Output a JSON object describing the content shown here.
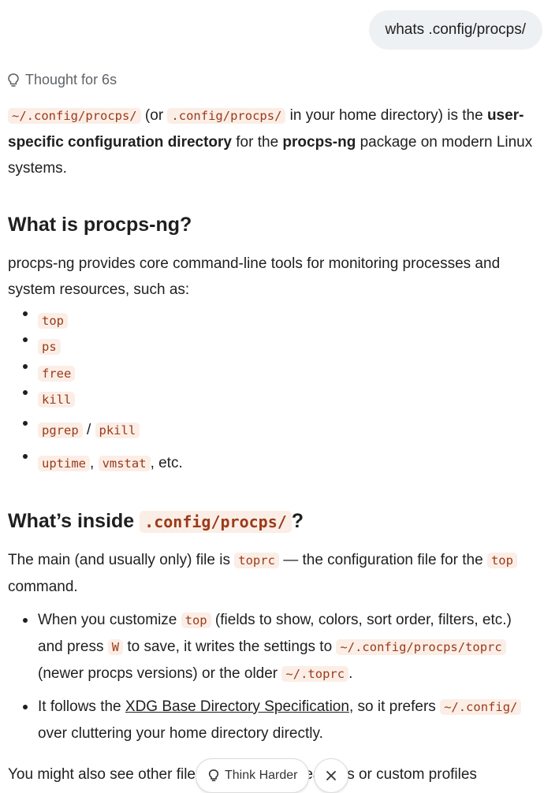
{
  "user_message": "whats .config/procps/",
  "thought_label": "Thought for 6s",
  "intro": {
    "code1": "~/.config/procps/",
    "t1": " (or ",
    "code2": ".config/procps/",
    "t2": " in your home directory) is the ",
    "b1": "user-specific configuration directory",
    "t3": " for the ",
    "b2": "procps-ng",
    "t4": " package on modern Linux systems."
  },
  "section1": {
    "heading": "What is procps-ng?",
    "para": "procps-ng provides core command-line tools for monitoring processes and system resources, such as:",
    "items": [
      "top",
      "ps",
      "free",
      "kill"
    ],
    "item5": {
      "a": "pgrep",
      "sep": " / ",
      "b": "pkill"
    },
    "item6": {
      "a": "uptime",
      "sep": ", ",
      "b": "vmstat",
      "tail": ", etc."
    }
  },
  "section2": {
    "heading_text": "What’s inside ",
    "heading_code": ".config/procps/",
    "heading_tail": "?",
    "para": {
      "t1": "The main (and usually only) file is ",
      "code1": "toprc",
      "t2": " — the configuration file for the ",
      "code2": "top",
      "t3": " command."
    },
    "bullet1": {
      "t1": "When you customize ",
      "code1": "top",
      "t2": " (fields to show, colors, sort order, filters, etc.) and press ",
      "code2": "W",
      "t3": " to save, it writes the settings to ",
      "code3": "~/.config/procps/toprc",
      "t4": " (newer procps versions) or the older ",
      "code4": "~/.toprc",
      "t5": "."
    },
    "bullet2": {
      "t1": "It follows the ",
      "link": "XDG Base Directory Specification",
      "t2": ", so it prefers ",
      "code1": "~/.config/",
      "t3": " over cluttering your home directory directly."
    },
    "trailing": "You might also see other files here for extra features or custom profiles"
  },
  "bottom_bar": {
    "think_harder": "Think Harder"
  }
}
